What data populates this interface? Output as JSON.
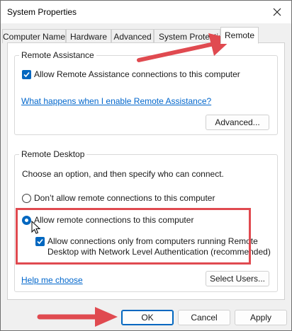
{
  "window": {
    "title": "System Properties"
  },
  "tabs": [
    {
      "label": "Computer Name"
    },
    {
      "label": "Hardware"
    },
    {
      "label": "Advanced"
    },
    {
      "label": "System Protection"
    },
    {
      "label": "Remote",
      "active": true
    }
  ],
  "remote_assistance": {
    "group_title": "Remote Assistance",
    "allow_checkbox_label": "Allow Remote Assistance connections to this computer",
    "allow_checked": true,
    "help_link": "What happens when I enable Remote Assistance?",
    "advanced_button": "Advanced..."
  },
  "remote_desktop": {
    "group_title": "Remote Desktop",
    "instruction": "Choose an option, and then specify who can connect.",
    "option_dont_allow": "Don’t allow remote connections to this computer",
    "option_allow": "Allow remote connections to this computer",
    "selected_option": "allow",
    "nla_checkbox_line1": "Allow connections only from computers running Remote",
    "nla_checkbox_line2": "Desktop with Network Level Authentication (recommended)",
    "nla_checked": true,
    "help_link": "Help me choose",
    "select_users_button": "Select Users..."
  },
  "footer": {
    "ok": "OK",
    "cancel": "Cancel",
    "apply": "Apply"
  },
  "colors": {
    "accent": "#0067c0",
    "annotation": "#e04a50",
    "link": "#0066cc"
  }
}
